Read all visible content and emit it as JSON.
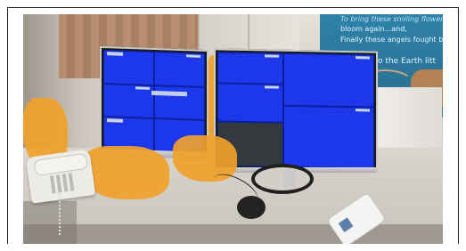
{
  "banner": {
    "line_1": "To bring these smiling flowers",
    "line_2": "bloom again...and,",
    "line_3": "Finally these angels fought b",
    "line_4": "o the Earth litt"
  },
  "scene": {
    "monitor_count": 2,
    "screen_color": "#1832e6",
    "accent_orange": "#f0a12a",
    "objects": [
      "desk-phone",
      "mouse",
      "remote-control",
      "orange-plastic-bags",
      "wall-banner"
    ]
  }
}
